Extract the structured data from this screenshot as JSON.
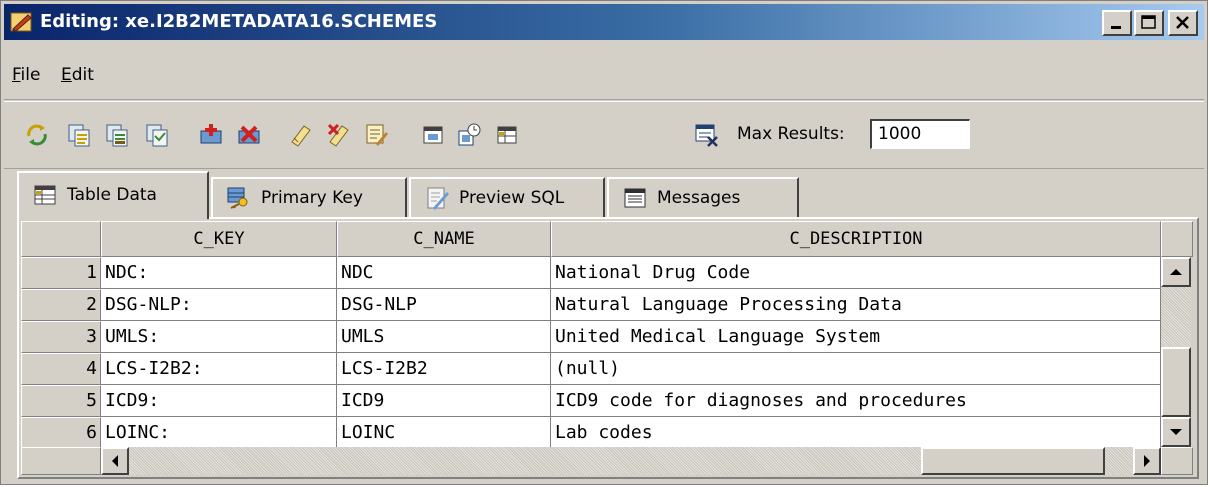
{
  "window": {
    "title": "Editing: xe.I2B2METADATA16.SCHEMES"
  },
  "menu": {
    "file": {
      "accel": "F",
      "rest": "ile"
    },
    "edit": {
      "accel": "E",
      "rest": "dit"
    }
  },
  "toolbar": {
    "icons": [
      "refresh-icon",
      "copy-row-icon",
      "paste-row-icon",
      "clone-row-icon",
      "insert-row-icon",
      "delete-row-icon",
      "commit-icon",
      "rollback-icon",
      "edit-icon",
      "filter-icon",
      "export-icon",
      "table-icon",
      "clear-icon"
    ],
    "max_results_label": "Max Results:",
    "max_results_value": "1000"
  },
  "tabs": [
    {
      "label": "Table Data",
      "icon": "table-icon",
      "active": true
    },
    {
      "label": "Primary Key",
      "icon": "key-icon",
      "active": false
    },
    {
      "label": "Preview SQL",
      "icon": "sql-icon",
      "active": false
    },
    {
      "label": "Messages",
      "icon": "messages-icon",
      "active": false
    }
  ],
  "table": {
    "columns": [
      "C_KEY",
      "C_NAME",
      "C_DESCRIPTION"
    ],
    "rows": [
      {
        "num": "1",
        "c_key": "NDC:",
        "c_name": "NDC",
        "c_description": "National Drug Code"
      },
      {
        "num": "2",
        "c_key": "DSG-NLP:",
        "c_name": "DSG-NLP",
        "c_description": "Natural Language Processing Data"
      },
      {
        "num": "3",
        "c_key": "UMLS:",
        "c_name": "UMLS",
        "c_description": "United Medical Language System"
      },
      {
        "num": "4",
        "c_key": "LCS-I2B2:",
        "c_name": "LCS-I2B2",
        "c_description": "(null)"
      },
      {
        "num": "5",
        "c_key": "ICD9:",
        "c_name": "ICD9",
        "c_description": "ICD9 code for diagnoses and procedures"
      },
      {
        "num": "6",
        "c_key": "LOINC:",
        "c_name": "LOINC",
        "c_description": "Lab codes"
      }
    ]
  },
  "colors": {
    "title_gradient_start": "#0a246a",
    "title_gradient_end": "#a6caf0",
    "window_bg": "#d4d0c8",
    "cell_bg": "#ffffff"
  }
}
